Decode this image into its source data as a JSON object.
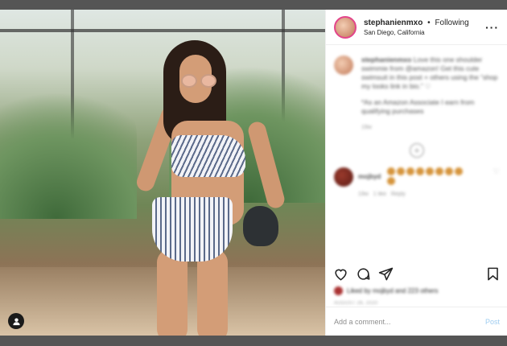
{
  "post": {
    "username": "stephanienmxo",
    "separator": "•",
    "follow_status": "Following",
    "location": "San Diego, California",
    "more_icon": "more-options-icon"
  },
  "caption": {
    "username": "stephanienmxo",
    "lines": [
      "Love this one shoulder swimmie from @amazon! Get this cute swimsuit in this post + others using the “shop my looks link in bio.” ♡",
      "*As an Amazon Associate I earn from qualifying purchases"
    ],
    "time": "19w"
  },
  "reply": {
    "username": "mojbyd",
    "emoji_count": 9,
    "time": "19w",
    "likes": "1 like",
    "reply_label": "Reply"
  },
  "likes_text": "Liked by mojbyd and 223 others",
  "date": "AUGUST 26, 2020",
  "comment_box": {
    "placeholder": "Add a comment...",
    "post_label": "Post"
  },
  "icons": [
    "heart-icon",
    "comment-icon",
    "share-icon",
    "bookmark-icon",
    "profile-tag-icon",
    "load-more-icon"
  ]
}
